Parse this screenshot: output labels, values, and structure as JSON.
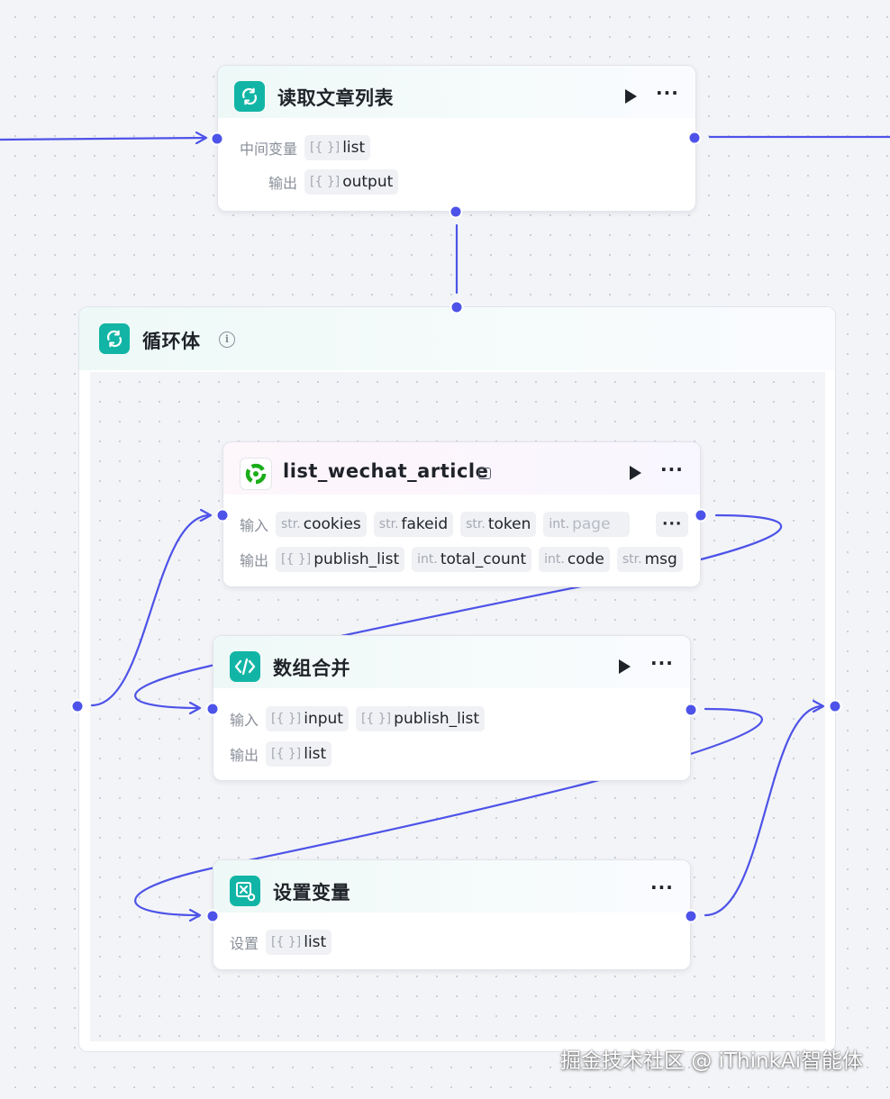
{
  "colors": {
    "wire": "#4d53e8",
    "teal_icon": "#12b5a5",
    "wechat_green": "#1aad19"
  },
  "node_read": {
    "title": "读取文章列表",
    "icon": "loop-arrows-icon",
    "rows": [
      {
        "label": "中间变量",
        "tags": [
          {
            "type": "[{ }]",
            "name": "list"
          }
        ]
      },
      {
        "label": "输出",
        "tags": [
          {
            "type": "[{ }]",
            "name": "output"
          }
        ]
      }
    ]
  },
  "loop_body": {
    "title": "循环体",
    "icon": "loop-arrows-icon",
    "info_icon": "info-icon"
  },
  "node_wechat": {
    "title": "list_wechat_article",
    "icon": "wechat-plugin-icon",
    "input_label": "输入",
    "inputs": [
      {
        "type": "str.",
        "name": "cookies"
      },
      {
        "type": "str.",
        "name": "fakeid"
      },
      {
        "type": "str.",
        "name": "token"
      },
      {
        "type": "int.",
        "name": "page"
      }
    ],
    "more": "···",
    "output_label": "输出",
    "outputs": [
      {
        "type": "[{ }]",
        "name": "publish_list"
      },
      {
        "type": "int.",
        "name": "total_count"
      },
      {
        "type": "int.",
        "name": "code"
      },
      {
        "type": "str.",
        "name": "msg"
      }
    ]
  },
  "node_merge": {
    "title": "数组合并",
    "icon": "code-icon",
    "input_label": "输入",
    "inputs": [
      {
        "type": "[{ }]",
        "name": "input"
      },
      {
        "type": "[{ }]",
        "name": "publish_list"
      }
    ],
    "output_label": "输出",
    "outputs": [
      {
        "type": "[{ }]",
        "name": "list"
      }
    ]
  },
  "node_setvar": {
    "title": "设置变量",
    "icon": "set-variable-icon",
    "set_label": "设置",
    "sets": [
      {
        "type": "[{ }]",
        "name": "list"
      }
    ]
  },
  "watermark": "掘金技术社区 @ iThinkAi智能体"
}
